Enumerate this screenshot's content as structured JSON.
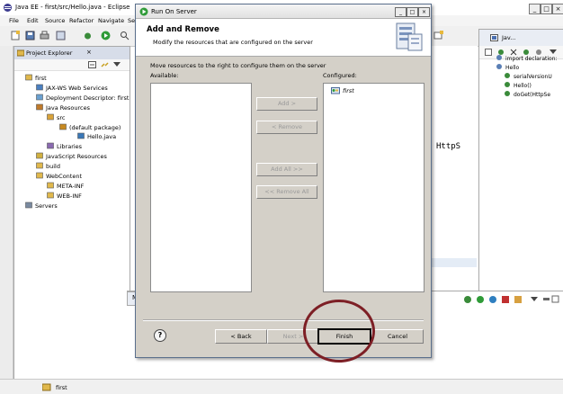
{
  "eclipse": {
    "title": "Java EE - first/src/Hello.java - Eclipse",
    "menu": [
      "File",
      "Edit",
      "Source",
      "Refactor",
      "Navigate",
      "Sear"
    ],
    "project_explorer": {
      "tab_label": "Project Explorer",
      "tree": [
        {
          "label": "first",
          "level": 0,
          "icon": "project-icon"
        },
        {
          "label": "JAX-WS Web Services",
          "level": 1,
          "icon": "webservice-icon"
        },
        {
          "label": "Deployment Descriptor: first",
          "level": 1,
          "icon": "descriptor-icon"
        },
        {
          "label": "Java Resources",
          "level": 1,
          "icon": "java-resources-icon"
        },
        {
          "label": "src",
          "level": 2,
          "icon": "package-folder-icon"
        },
        {
          "label": "(default package)",
          "level": 3,
          "icon": "package-icon"
        },
        {
          "label": "Hello.java",
          "level": 4,
          "icon": "java-file-icon"
        },
        {
          "label": "Libraries",
          "level": 2,
          "icon": "library-icon"
        },
        {
          "label": "JavaScript Resources",
          "level": 1,
          "icon": "js-resources-icon"
        },
        {
          "label": "build",
          "level": 1,
          "icon": "folder-icon"
        },
        {
          "label": "WebContent",
          "level": 1,
          "icon": "folder-icon"
        },
        {
          "label": "META-INF",
          "level": 2,
          "icon": "folder-icon"
        },
        {
          "label": "WEB-INF",
          "level": 2,
          "icon": "folder-icon"
        },
        {
          "label": "Servers",
          "level": 0,
          "icon": "servers-icon"
        }
      ]
    },
    "editor": {
      "visible_code": "HttpS"
    },
    "outline": {
      "perspective_tab": "Jav...",
      "items": [
        {
          "label": "import declaration:",
          "level": 0
        },
        {
          "label": "Hello",
          "level": 0
        },
        {
          "label": "serialVersionU",
          "level": 1
        },
        {
          "label": "Hello()",
          "level": 1
        },
        {
          "label": "doGet(HttpSe",
          "level": 1
        }
      ]
    },
    "bottom_tab": "M",
    "status_text": "first"
  },
  "dialog": {
    "title": "Run On Server",
    "heading": "Add and Remove",
    "subheading": "Modify the resources that are configured on the server",
    "instruction": "Move resources to the right to configure them on the server",
    "available_label": "Available:",
    "configured_label": "Configured:",
    "available_items": [],
    "configured_items": [
      "first"
    ],
    "buttons": {
      "add": "Add >",
      "remove": "< Remove",
      "add_all": "Add All >>",
      "remove_all": "<< Remove All",
      "help": "?",
      "back": "< Back",
      "next": "Next >",
      "finish": "Finish",
      "cancel": "Cancel"
    }
  },
  "colors": {
    "annotation_circle": "#7d1f25",
    "dialog_face": "#d4d0c8"
  }
}
